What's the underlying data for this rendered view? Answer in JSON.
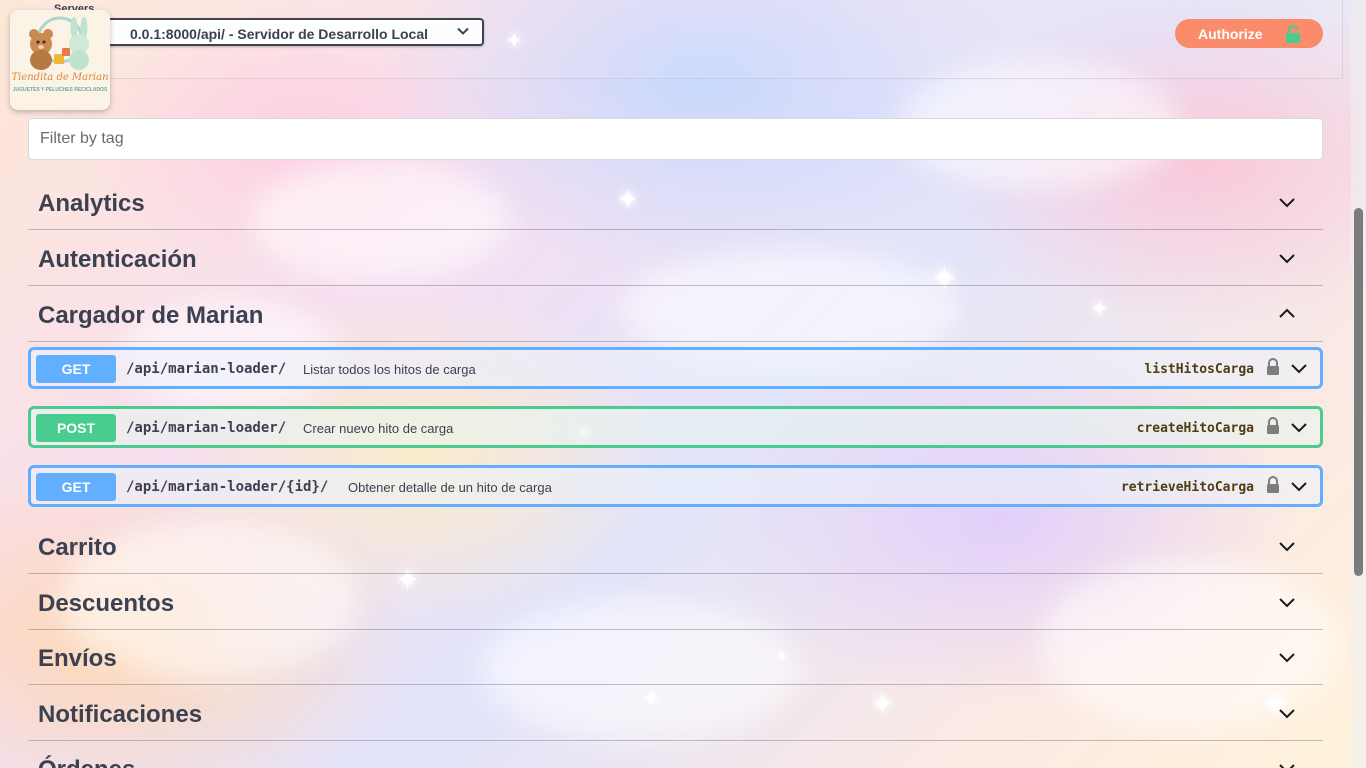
{
  "servers": {
    "label": "Servers",
    "selected": "0.0.1:8000/api/ - Servidor de Desarrollo Local"
  },
  "logo": {
    "name": "Tiendita de Marian",
    "tagline": "JUGUETES Y PELUCHES RECICLADOS"
  },
  "authorize": {
    "label": "Authorize"
  },
  "filter": {
    "placeholder": "Filter by tag"
  },
  "tags": {
    "analytics": "Analytics",
    "autenticacion": "Autenticación",
    "cargador": "Cargador de Marian",
    "carrito": "Carrito",
    "descuentos": "Descuentos",
    "envios": "Envíos",
    "notificaciones": "Notificaciones",
    "ordenes": "Órdenes"
  },
  "operations": [
    {
      "method": "GET",
      "path": "/api/marian-loader/",
      "summary": "Listar todos los hitos de carga",
      "operation_id": "listHitosCarga"
    },
    {
      "method": "POST",
      "path": "/api/marian-loader/",
      "summary": "Crear nuevo hito de carga",
      "operation_id": "createHitoCarga"
    },
    {
      "method": "GET",
      "path": "/api/marian-loader/{id}/",
      "summary": "Obtener detalle de un hito de carga",
      "operation_id": "retrieveHitoCarga"
    }
  ],
  "colors": {
    "get": "#61affe",
    "post": "#49cc90",
    "authorize": "#fb8c6b",
    "text": "#3b4151"
  },
  "icons": {
    "expand": "chevron-down-icon",
    "collapse": "chevron-up-icon",
    "lock": "lock-icon",
    "unlock": "unlock-icon"
  }
}
